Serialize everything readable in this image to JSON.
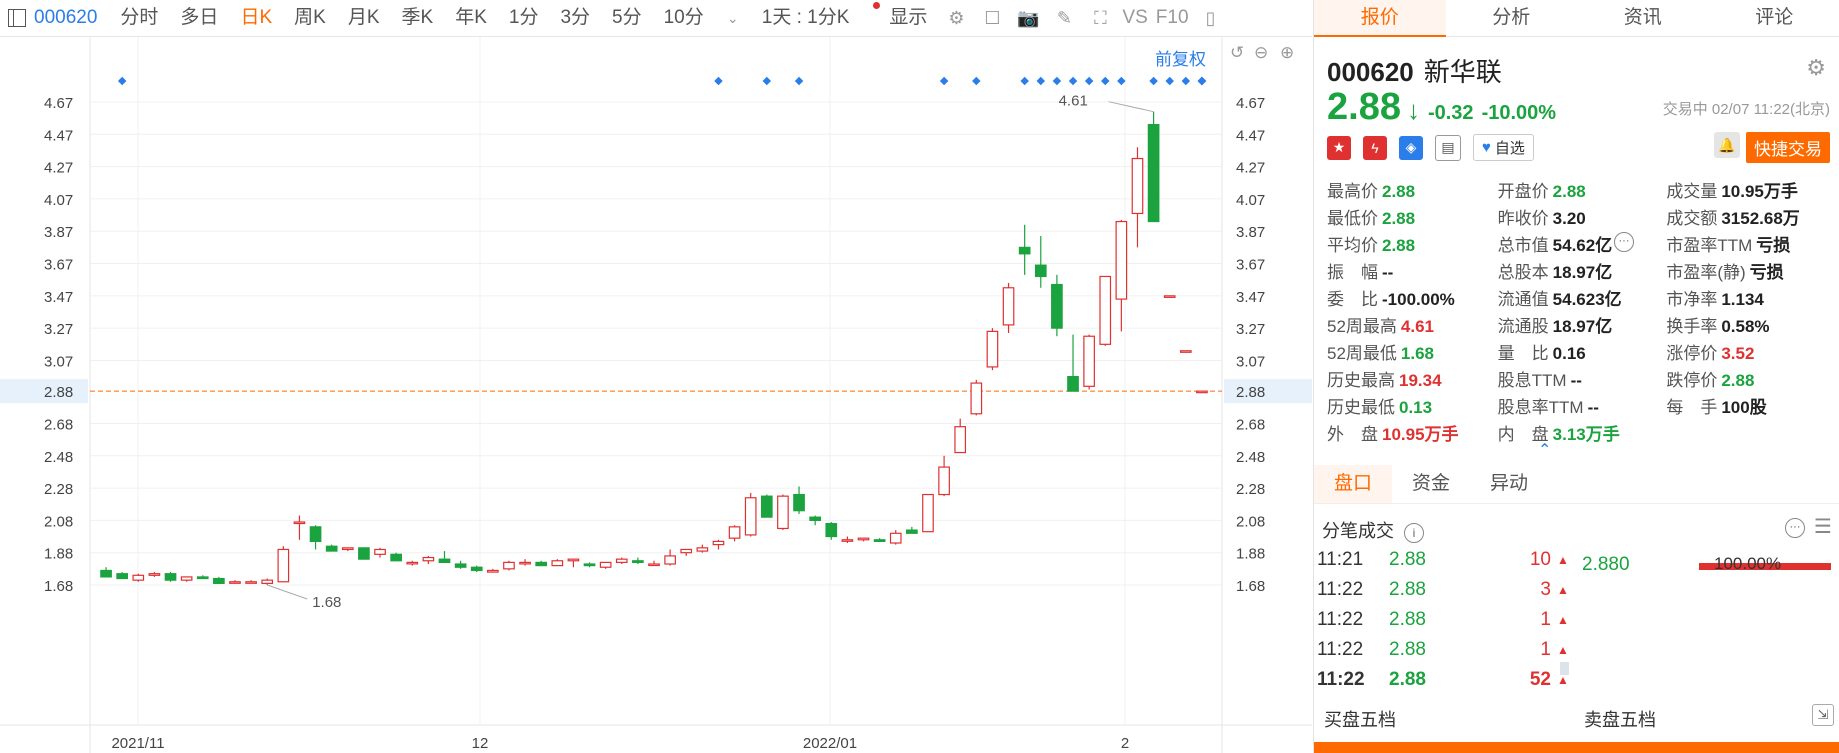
{
  "toolbar": {
    "code": "000620",
    "periods": [
      "分时",
      "多日",
      "日K",
      "周K",
      "月K",
      "季K",
      "年K",
      "1分",
      "3分",
      "5分",
      "10分"
    ],
    "active_period": "日K",
    "range": "1天 : 1分K",
    "display": "显示",
    "vs": "VS",
    "f10": "F10"
  },
  "chart": {
    "adjust": "前复权",
    "hline_price": "2.88",
    "max_label": "4.61",
    "min_label": "1.68",
    "y_ticks": [
      "4.67",
      "4.47",
      "4.27",
      "4.07",
      "3.87",
      "3.67",
      "3.47",
      "3.27",
      "3.07",
      "2.88",
      "2.68",
      "2.48",
      "2.28",
      "2.08",
      "1.88",
      "1.68"
    ],
    "x_labels": [
      "2021/11",
      "12",
      "2022/01",
      "2"
    ],
    "colors": {
      "up": "#e03131",
      "down": "#1aa33e",
      "accent": "#2b7de9",
      "line": "#ff6a00"
    }
  },
  "candles": [
    {
      "o": 1.77,
      "h": 1.79,
      "l": 1.73,
      "c": 1.73
    },
    {
      "o": 1.75,
      "h": 1.76,
      "l": 1.72,
      "c": 1.72
    },
    {
      "o": 1.71,
      "h": 1.75,
      "l": 1.7,
      "c": 1.74
    },
    {
      "o": 1.74,
      "h": 1.76,
      "l": 1.73,
      "c": 1.75
    },
    {
      "o": 1.75,
      "h": 1.76,
      "l": 1.7,
      "c": 1.71
    },
    {
      "o": 1.71,
      "h": 1.73,
      "l": 1.7,
      "c": 1.73
    },
    {
      "o": 1.73,
      "h": 1.74,
      "l": 1.72,
      "c": 1.72
    },
    {
      "o": 1.72,
      "h": 1.73,
      "l": 1.69,
      "c": 1.69
    },
    {
      "o": 1.7,
      "h": 1.71,
      "l": 1.7,
      "c": 1.7
    },
    {
      "o": 1.7,
      "h": 1.71,
      "l": 1.7,
      "c": 1.7
    },
    {
      "o": 1.69,
      "h": 1.72,
      "l": 1.68,
      "c": 1.71
    },
    {
      "o": 1.7,
      "h": 1.92,
      "l": 1.7,
      "c": 1.9
    },
    {
      "o": 2.07,
      "h": 2.11,
      "l": 1.96,
      "c": 2.07
    },
    {
      "o": 2.04,
      "h": 2.05,
      "l": 1.9,
      "c": 1.95
    },
    {
      "o": 1.92,
      "h": 1.93,
      "l": 1.89,
      "c": 1.89
    },
    {
      "o": 1.9,
      "h": 1.91,
      "l": 1.89,
      "c": 1.91
    },
    {
      "o": 1.91,
      "h": 1.91,
      "l": 1.84,
      "c": 1.84
    },
    {
      "o": 1.87,
      "h": 1.91,
      "l": 1.85,
      "c": 1.9
    },
    {
      "o": 1.87,
      "h": 1.88,
      "l": 1.83,
      "c": 1.83
    },
    {
      "o": 1.82,
      "h": 1.83,
      "l": 1.8,
      "c": 1.82
    },
    {
      "o": 1.83,
      "h": 1.86,
      "l": 1.81,
      "c": 1.85
    },
    {
      "o": 1.84,
      "h": 1.89,
      "l": 1.82,
      "c": 1.82
    },
    {
      "o": 1.81,
      "h": 1.83,
      "l": 1.78,
      "c": 1.79
    },
    {
      "o": 1.79,
      "h": 1.8,
      "l": 1.76,
      "c": 1.77
    },
    {
      "o": 1.76,
      "h": 1.78,
      "l": 1.76,
      "c": 1.77
    },
    {
      "o": 1.78,
      "h": 1.83,
      "l": 1.77,
      "c": 1.82
    },
    {
      "o": 1.82,
      "h": 1.84,
      "l": 1.8,
      "c": 1.82
    },
    {
      "o": 1.82,
      "h": 1.83,
      "l": 1.8,
      "c": 1.8
    },
    {
      "o": 1.8,
      "h": 1.84,
      "l": 1.8,
      "c": 1.83
    },
    {
      "o": 1.83,
      "h": 1.84,
      "l": 1.79,
      "c": 1.84
    },
    {
      "o": 1.81,
      "h": 1.82,
      "l": 1.79,
      "c": 1.8
    },
    {
      "o": 1.79,
      "h": 1.82,
      "l": 1.78,
      "c": 1.82
    },
    {
      "o": 1.82,
      "h": 1.85,
      "l": 1.81,
      "c": 1.84
    },
    {
      "o": 1.83,
      "h": 1.85,
      "l": 1.81,
      "c": 1.82
    },
    {
      "o": 1.81,
      "h": 1.83,
      "l": 1.8,
      "c": 1.81
    },
    {
      "o": 1.81,
      "h": 1.9,
      "l": 1.8,
      "c": 1.86
    },
    {
      "o": 1.88,
      "h": 1.9,
      "l": 1.86,
      "c": 1.9
    },
    {
      "o": 1.89,
      "h": 1.93,
      "l": 1.88,
      "c": 1.91
    },
    {
      "o": 1.93,
      "h": 1.96,
      "l": 1.9,
      "c": 1.95
    },
    {
      "o": 1.97,
      "h": 2.05,
      "l": 1.95,
      "c": 2.04
    },
    {
      "o": 1.99,
      "h": 2.25,
      "l": 1.98,
      "c": 2.22
    },
    {
      "o": 2.23,
      "h": 2.24,
      "l": 2.1,
      "c": 2.1
    },
    {
      "o": 2.03,
      "h": 2.24,
      "l": 2.02,
      "c": 2.23
    },
    {
      "o": 2.24,
      "h": 2.29,
      "l": 2.12,
      "c": 2.14
    },
    {
      "o": 2.1,
      "h": 2.11,
      "l": 2.05,
      "c": 2.08
    },
    {
      "o": 2.06,
      "h": 2.07,
      "l": 1.96,
      "c": 1.98
    },
    {
      "o": 1.96,
      "h": 1.98,
      "l": 1.94,
      "c": 1.96
    },
    {
      "o": 1.96,
      "h": 1.97,
      "l": 1.95,
      "c": 1.97
    },
    {
      "o": 1.96,
      "h": 1.97,
      "l": 1.95,
      "c": 1.95
    },
    {
      "o": 1.94,
      "h": 2.02,
      "l": 1.93,
      "c": 2.0
    },
    {
      "o": 2.02,
      "h": 2.04,
      "l": 2.0,
      "c": 2.0
    },
    {
      "o": 2.01,
      "h": 2.24,
      "l": 2.01,
      "c": 2.24
    },
    {
      "o": 2.24,
      "h": 2.48,
      "l": 2.23,
      "c": 2.41
    },
    {
      "o": 2.5,
      "h": 2.71,
      "l": 2.5,
      "c": 2.66
    },
    {
      "o": 2.74,
      "h": 2.95,
      "l": 2.73,
      "c": 2.93
    },
    {
      "o": 3.03,
      "h": 3.27,
      "l": 3.01,
      "c": 3.25
    },
    {
      "o": 3.29,
      "h": 3.55,
      "l": 3.24,
      "c": 3.52
    },
    {
      "o": 3.77,
      "h": 3.91,
      "l": 3.6,
      "c": 3.73
    },
    {
      "o": 3.66,
      "h": 3.84,
      "l": 3.52,
      "c": 3.59
    },
    {
      "o": 3.54,
      "h": 3.6,
      "l": 3.22,
      "c": 3.27
    },
    {
      "o": 2.97,
      "h": 3.23,
      "l": 2.92,
      "c": 2.88
    },
    {
      "o": 2.91,
      "h": 3.23,
      "l": 2.89,
      "c": 3.22
    },
    {
      "o": 3.17,
      "h": 3.59,
      "l": 3.16,
      "c": 3.59
    },
    {
      "o": 3.45,
      "h": 3.94,
      "l": 3.25,
      "c": 3.93
    },
    {
      "o": 3.98,
      "h": 4.39,
      "l": 3.77,
      "c": 4.32
    },
    {
      "o": 4.53,
      "h": 4.61,
      "l": 3.93,
      "c": 3.93
    },
    {
      "o": 3.47,
      "h": 3.47,
      "l": 3.47,
      "c": 3.47
    },
    {
      "o": 3.13,
      "h": 3.13,
      "l": 3.13,
      "c": 3.13
    },
    {
      "o": 2.88,
      "h": 2.88,
      "l": 2.88,
      "c": 2.88
    }
  ],
  "stock": {
    "code": "000620",
    "name": "新华联",
    "price": "2.88",
    "change": "-0.32",
    "change_pct": "-10.00%",
    "status_time": "交易中 02/07 11:22(北京)",
    "watch_label": "自选",
    "quick_trade": "快捷交易"
  },
  "stats": [
    [
      {
        "l": "最高价",
        "v": "2.88",
        "c": "green"
      },
      {
        "l": "开盘价",
        "v": "2.88",
        "c": "green"
      },
      {
        "l": "成交量",
        "v": "10.95万手",
        "c": ""
      }
    ],
    [
      {
        "l": "最低价",
        "v": "2.88",
        "c": "green"
      },
      {
        "l": "昨收价",
        "v": "3.20",
        "c": ""
      },
      {
        "l": "成交额",
        "v": "3152.68万",
        "c": ""
      }
    ],
    [
      {
        "l": "平均价",
        "v": "2.88",
        "c": "green"
      },
      {
        "l": "总市值",
        "v": "54.62亿",
        "c": ""
      },
      {
        "l": "市盈率TTM",
        "v": "亏损",
        "c": ""
      }
    ],
    [
      {
        "l": "振　幅",
        "v": "--",
        "c": ""
      },
      {
        "l": "总股本",
        "v": "18.97亿",
        "c": ""
      },
      {
        "l": "市盈率(静)",
        "v": "亏损",
        "c": ""
      }
    ],
    [
      {
        "l": "委　比",
        "v": "-100.00%",
        "c": ""
      },
      {
        "l": "流通值",
        "v": "54.623亿",
        "c": ""
      },
      {
        "l": "市净率",
        "v": "1.134",
        "c": ""
      }
    ],
    [
      {
        "l": "52周最高",
        "v": "4.61",
        "c": "red"
      },
      {
        "l": "流通股",
        "v": "18.97亿",
        "c": ""
      },
      {
        "l": "换手率",
        "v": "0.58%",
        "c": ""
      }
    ],
    [
      {
        "l": "52周最低",
        "v": "1.68",
        "c": "green"
      },
      {
        "l": "量　比",
        "v": "0.16",
        "c": ""
      },
      {
        "l": "涨停价",
        "v": "3.52",
        "c": "red"
      }
    ],
    [
      {
        "l": "历史最高",
        "v": "19.34",
        "c": "red"
      },
      {
        "l": "股息TTM",
        "v": "--",
        "c": ""
      },
      {
        "l": "跌停价",
        "v": "2.88",
        "c": "green"
      }
    ],
    [
      {
        "l": "历史最低",
        "v": "0.13",
        "c": "green"
      },
      {
        "l": "股息率TTM",
        "v": "--",
        "c": ""
      },
      {
        "l": "每　手",
        "v": "100股",
        "c": ""
      }
    ],
    [
      {
        "l": "外　盘",
        "v": "10.95万手",
        "c": "red"
      },
      {
        "l": "内　盘",
        "v": "3.13万手",
        "c": "green"
      },
      {
        "l": "",
        "v": "",
        "c": ""
      }
    ]
  ],
  "right_tabs": [
    "报价",
    "分析",
    "资讯",
    "评论"
  ],
  "sub_tabs": [
    "盘口",
    "资金",
    "异动"
  ],
  "ticks_title": "分笔成交",
  "ticks": [
    {
      "t": "11:21",
      "p": "2.88",
      "v": "10"
    },
    {
      "t": "11:22",
      "p": "2.88",
      "v": "3"
    },
    {
      "t": "11:22",
      "p": "2.88",
      "v": "1"
    },
    {
      "t": "11:22",
      "p": "2.88",
      "v": "1"
    },
    {
      "t": "11:22",
      "p": "2.88",
      "v": "52"
    }
  ],
  "tick_side": {
    "price": "2.880",
    "pct": "100.00%"
  },
  "book": {
    "buy": "买盘五档",
    "sell": "卖盘五档"
  }
}
